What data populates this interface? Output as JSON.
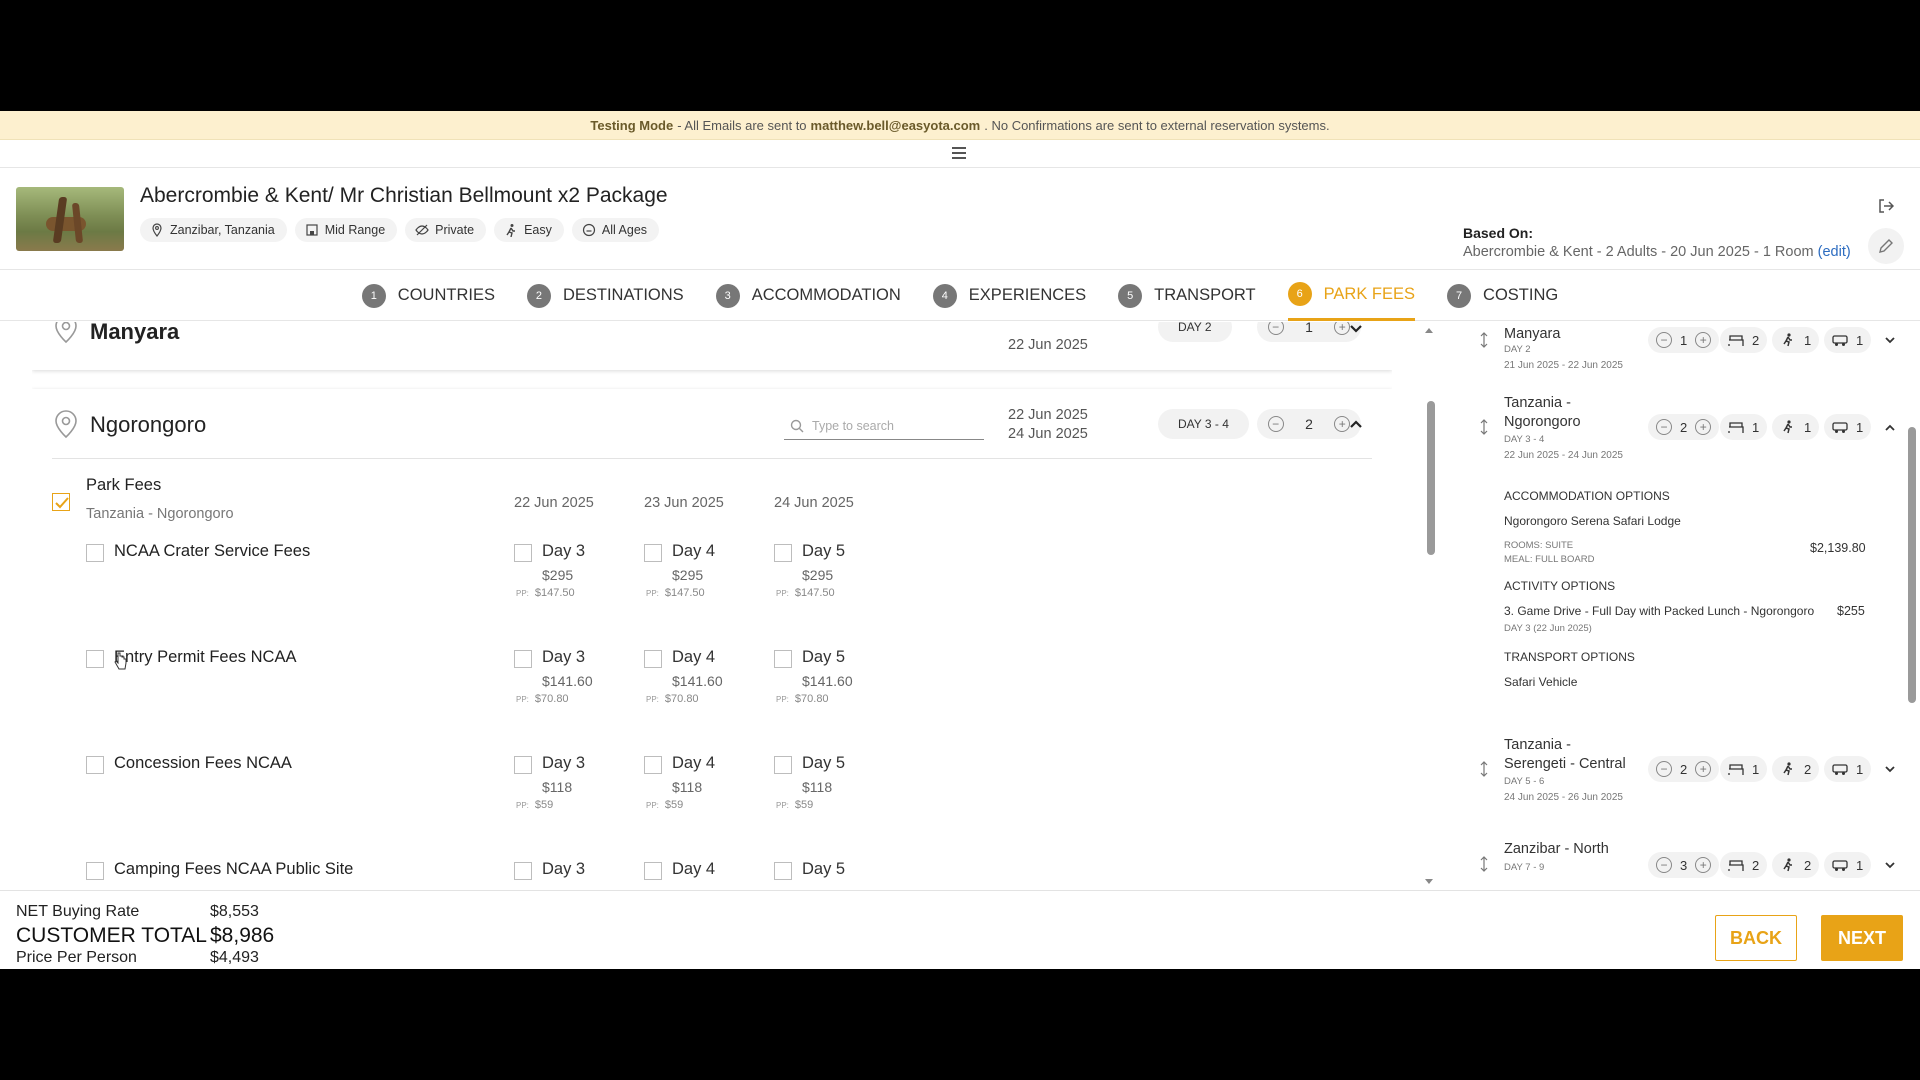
{
  "testing_banner": {
    "label": "Testing Mode",
    "text1": "- All Emails are sent to",
    "email": "matthew.bell@easyota.com",
    "text2": ". No Confirmations are sent to external reservation systems."
  },
  "package": {
    "title": "Abercrombie & Kent/ Mr Christian Bellmount x2 Package",
    "chips": [
      "Zanzibar, Tanzania",
      "Mid Range",
      "Private",
      "Easy",
      "All Ages"
    ],
    "based_on_label": "Based On:",
    "based_on_value": "Abercrombie & Kent - 2 Adults - 20 Jun 2025 - 1 Room",
    "edit_link": "(edit)"
  },
  "steps": [
    {
      "num": "1",
      "label": "COUNTRIES"
    },
    {
      "num": "2",
      "label": "DESTINATIONS"
    },
    {
      "num": "3",
      "label": "ACCOMMODATION"
    },
    {
      "num": "4",
      "label": "EXPERIENCES"
    },
    {
      "num": "5",
      "label": "TRANSPORT"
    },
    {
      "num": "6",
      "label": "PARK FEES"
    },
    {
      "num": "7",
      "label": "COSTING"
    }
  ],
  "active_step": "PARK FEES",
  "manyara_card": {
    "name": "Manyara",
    "date": "22 Jun 2025",
    "day": "DAY 2",
    "count": "1"
  },
  "ngoro_card": {
    "name": "Ngorongoro",
    "search_placeholder": "Type to search",
    "date_from": "22 Jun 2025",
    "date_to": "24 Jun 2025",
    "day": "DAY 3 - 4",
    "count": "2",
    "park_fees_title": "Park Fees",
    "park_fees_sub": "Tanzania - Ngorongoro",
    "col_dates": [
      "22 Jun 2025",
      "23 Jun 2025",
      "24 Jun 2025"
    ],
    "pp_label": "PP:",
    "fees": [
      {
        "name": "NCAA Crater Service Fees",
        "days": [
          {
            "day": "Day 3",
            "price": "$295",
            "pp": "$147.50"
          },
          {
            "day": "Day 4",
            "price": "$295",
            "pp": "$147.50"
          },
          {
            "day": "Day 5",
            "price": "$295",
            "pp": "$147.50"
          }
        ]
      },
      {
        "name": "Entry Permit Fees NCAA",
        "days": [
          {
            "day": "Day 3",
            "price": "$141.60",
            "pp": "$70.80"
          },
          {
            "day": "Day 4",
            "price": "$141.60",
            "pp": "$70.80"
          },
          {
            "day": "Day 5",
            "price": "$141.60",
            "pp": "$70.80"
          }
        ]
      },
      {
        "name": "Concession Fees NCAA",
        "days": [
          {
            "day": "Day 3",
            "price": "$118",
            "pp": "$59"
          },
          {
            "day": "Day 4",
            "price": "$118",
            "pp": "$59"
          },
          {
            "day": "Day 5",
            "price": "$118",
            "pp": "$59"
          }
        ]
      },
      {
        "name": "Camping Fees NCAA Public Site",
        "days": [
          {
            "day": "Day 3"
          },
          {
            "day": "Day 4"
          },
          {
            "day": "Day 5"
          }
        ]
      }
    ]
  },
  "sidebar": {
    "items": [
      {
        "name": "Manyara",
        "day": "DAY 2",
        "range": "21 Jun 2025 - 22 Jun 2025",
        "count": "1",
        "beds": "2",
        "act": "1",
        "trans": "1"
      },
      {
        "name": "Tanzania - Ngorongoro",
        "day": "DAY 3 - 4",
        "range": "22 Jun 2025 - 24 Jun 2025",
        "count": "2",
        "beds": "1",
        "act": "1",
        "trans": "1"
      },
      {
        "name": "Tanzania - Serengeti - Central",
        "day": "DAY 5 - 6",
        "range": "24 Jun 2025 - 26 Jun 2025",
        "count": "2",
        "beds": "1",
        "act": "2",
        "trans": "1"
      },
      {
        "name": "Zanzibar - North",
        "day": "DAY 7 - 9",
        "count": "3",
        "beds": "2",
        "act": "2",
        "trans": "1"
      }
    ],
    "details": {
      "accom_header": "ACCOMMODATION OPTIONS",
      "accom_name": "Ngorongoro Serena Safari Lodge",
      "rooms": "ROOMS: SUITE",
      "meal": "MEAL: FULL BOARD",
      "accom_price": "$2,139.80",
      "activity_header": "ACTIVITY OPTIONS",
      "activity_name": "3. Game Drive - Full Day with Packed Lunch - Ngorongoro",
      "activity_price": "$255",
      "activity_day": "DAY 3  (22 Jun 2025)",
      "transport_header": "TRANSPORT OPTIONS",
      "transport_name": "Safari Vehicle"
    }
  },
  "footer": {
    "net_label": "NET Buying Rate",
    "net_value": "$8,553",
    "total_label": "CUSTOMER TOTAL",
    "total_value": "$8,986",
    "pp_label": "Price Per Person",
    "pp_value": "$4,493",
    "back": "BACK",
    "next": "NEXT"
  },
  "colors": {
    "accent": "#e8a317",
    "banner": "#fdf0cf",
    "link": "#2c6cc0"
  }
}
